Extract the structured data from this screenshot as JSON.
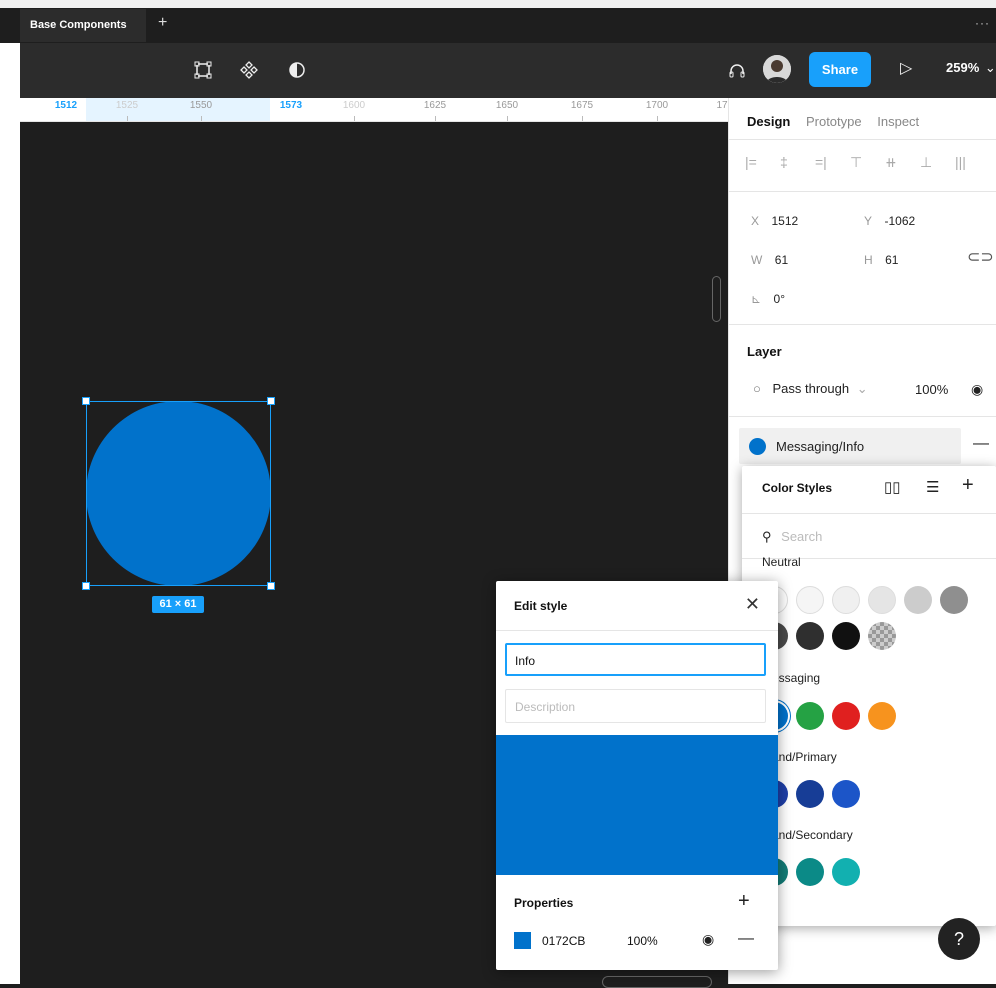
{
  "tabbar": {
    "tab_label": "Base Components",
    "add_tab": "+",
    "more": "···"
  },
  "toolbar": {
    "share_label": "Share",
    "zoom_level": "259%",
    "zoom_chevron": "⌄",
    "play_icon": "▷"
  },
  "ruler": {
    "ticks": [
      "1512",
      "1525",
      "1550",
      "1573",
      "1600",
      "1625",
      "1650",
      "1675",
      "1700",
      "17"
    ]
  },
  "canvas": {
    "size_badge": "61 × 61",
    "fill_color": "#0172cb",
    "selection_color": "#18a0fb"
  },
  "panel": {
    "tabs": [
      "Design",
      "Prototype",
      "Inspect"
    ],
    "x_label": "X",
    "x_value": "1512",
    "y_label": "Y",
    "y_value": "-1062",
    "w_label": "W",
    "w_value": "61",
    "h_label": "H",
    "h_value": "61",
    "rotation": "0°",
    "layer_heading": "Layer",
    "blend_mode": "Pass through",
    "opacity": "100%",
    "fill_style_name": "Messaging/Info"
  },
  "color_styles": {
    "title": "Color Styles",
    "search_placeholder": "Search",
    "groups": [
      {
        "label": "Neutral",
        "colors": [
          "#ffffff",
          "#f5f5f5",
          "#f0f0f0",
          "#e5e5e5",
          "#cccccc",
          "#8f8f8f",
          "#4a4a4a",
          "#2f2f2f",
          "#111111",
          "#b8b8b8"
        ]
      },
      {
        "label": "essaging",
        "colors": [
          "#0172cb",
          "#25a244",
          "#e0201f",
          "#f7931e"
        ]
      },
      {
        "label": "and/Primary",
        "colors": [
          "#1e3fa8",
          "#173d96",
          "#1c55c8"
        ]
      },
      {
        "label": "and/Secondary",
        "colors": [
          "#127c77",
          "#0b8a87",
          "#12b0b0"
        ]
      }
    ]
  },
  "edit_style": {
    "title": "Edit style",
    "name_value": "Info",
    "description_placeholder": "Description",
    "properties_heading": "Properties",
    "add": "+",
    "hex": "0172CB",
    "opacity": "100%",
    "color": "#0172cb"
  },
  "help": "?"
}
